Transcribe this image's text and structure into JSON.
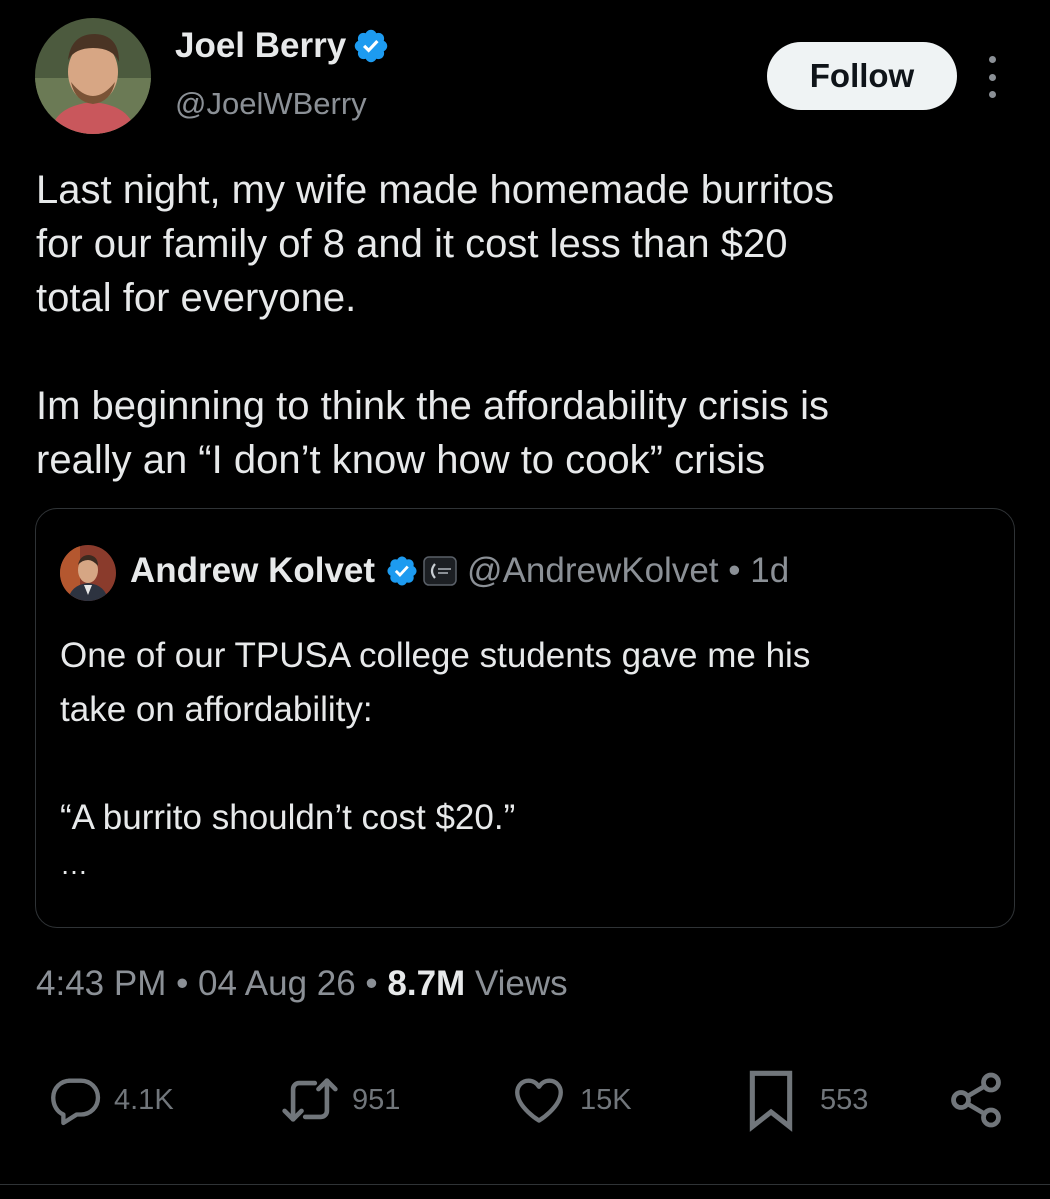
{
  "author": {
    "name": "Joel Berry",
    "handle": "@JoelWBerry",
    "verified": true
  },
  "follow_label": "Follow",
  "tweet": {
    "lines": [
      "Last night, my wife made homemade burritos",
      "for our family of 8 and it cost less than $20",
      "total for everyone.",
      "",
      "Im beginning to think the affordability crisis is",
      "really an “I don’t know how to cook” crisis"
    ]
  },
  "quote": {
    "name": "Andrew Kolvet",
    "verified": true,
    "affiliation_badge": "org-badge-icon",
    "handle_time": "@AndrewKolvet • 1d",
    "lines": [
      "One of our TPUSA college students gave me his",
      "take on affordability:",
      "",
      "“A burrito shouldn’t cost $20.”",
      "…"
    ]
  },
  "meta": {
    "time_date": "4:43 PM • 04 Aug 26 • ",
    "views_count": "8.7M",
    "views_label": " Views"
  },
  "actions": {
    "replies": "4.1K",
    "reposts": "951",
    "likes": "15K",
    "bookmarks": "553"
  },
  "colors": {
    "background": "#000000",
    "text": "#e7e9ea",
    "secondary": "#8b9096",
    "verified": "#1d9bf0",
    "follow_bg": "#eff3f4"
  }
}
